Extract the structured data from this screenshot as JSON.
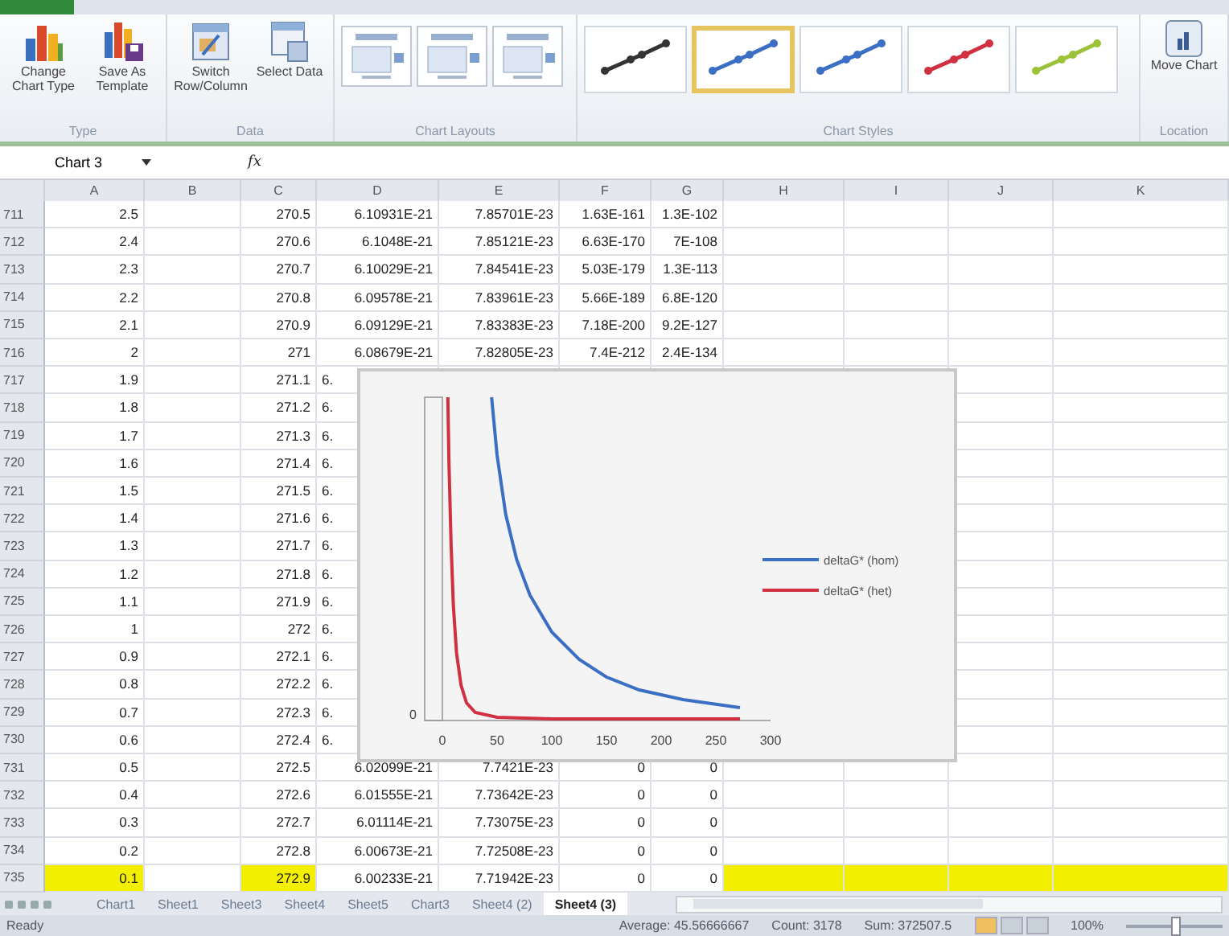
{
  "ribbon": {
    "groups": [
      {
        "label": "Type",
        "kind": "buttons",
        "buttons": [
          {
            "label": "Change Chart Type"
          },
          {
            "label": "Save As Template"
          }
        ]
      },
      {
        "label": "Data",
        "kind": "buttons",
        "buttons": [
          {
            "label": "Switch Row/Column"
          },
          {
            "label": "Select Data"
          }
        ]
      },
      {
        "label": "Chart Layouts",
        "kind": "layouts"
      },
      {
        "label": "Chart Styles",
        "kind": "styles",
        "styles": [
          {
            "color": "#333333",
            "selected": false
          },
          {
            "color": "#3b6fc4",
            "selected": true
          },
          {
            "color": "#3b6fc4",
            "selected": false
          },
          {
            "color": "#d03040",
            "selected": false
          },
          {
            "color": "#9cc23a",
            "selected": false
          }
        ]
      },
      {
        "label": "Location",
        "kind": "buttons",
        "buttons": [
          {
            "label": "Move Chart"
          }
        ]
      }
    ]
  },
  "formula_bar": {
    "name_box": "Chart 3",
    "fx": "fx"
  },
  "columns": [
    "A",
    "B",
    "C",
    "D",
    "E",
    "F",
    "G",
    "H",
    "I",
    "J",
    "K"
  ],
  "rows": [
    {
      "num": "711",
      "kind": "full",
      "cells": {
        "A": "2.5",
        "C": "270.5",
        "D": "6.10931E-21",
        "E": "7.85701E-23",
        "F": "1.63E-161",
        "G": "1.3E-102"
      }
    },
    {
      "num": "712",
      "kind": "full",
      "cells": {
        "A": "2.4",
        "C": "270.6",
        "D": "6.1048E-21",
        "E": "7.85121E-23",
        "F": "6.63E-170",
        "G": "7E-108"
      }
    },
    {
      "num": "713",
      "kind": "full",
      "cells": {
        "A": "2.3",
        "C": "270.7",
        "D": "6.10029E-21",
        "E": "7.84541E-23",
        "F": "5.03E-179",
        "G": "1.3E-113"
      }
    },
    {
      "num": "714",
      "kind": "full",
      "cells": {
        "A": "2.2",
        "C": "270.8",
        "D": "6.09578E-21",
        "E": "7.83961E-23",
        "F": "5.66E-189",
        "G": "6.8E-120"
      }
    },
    {
      "num": "715",
      "kind": "full",
      "cells": {
        "A": "2.1",
        "C": "270.9",
        "D": "6.09129E-21",
        "E": "7.83383E-23",
        "F": "7.18E-200",
        "G": "9.2E-127"
      }
    },
    {
      "num": "716",
      "kind": "full",
      "cells": {
        "A": "2",
        "C": "271",
        "D": "6.08679E-21",
        "E": "7.82805E-23",
        "F": "7.4E-212",
        "G": "2.4E-134"
      }
    },
    {
      "num": "717",
      "kind": "covered",
      "cells": {
        "A": "1.9",
        "C": "271.1",
        "D": "6."
      }
    },
    {
      "num": "718",
      "kind": "covered",
      "cells": {
        "A": "1.8",
        "C": "271.2",
        "D": "6."
      }
    },
    {
      "num": "719",
      "kind": "covered",
      "cells": {
        "A": "1.7",
        "C": "271.3",
        "D": "6."
      }
    },
    {
      "num": "720",
      "kind": "covered",
      "cells": {
        "A": "1.6",
        "C": "271.4",
        "D": "6."
      }
    },
    {
      "num": "721",
      "kind": "covered",
      "cells": {
        "A": "1.5",
        "C": "271.5",
        "D": "6."
      }
    },
    {
      "num": "722",
      "kind": "covered",
      "cells": {
        "A": "1.4",
        "C": "271.6",
        "D": "6."
      }
    },
    {
      "num": "723",
      "kind": "covered",
      "cells": {
        "A": "1.3",
        "C": "271.7",
        "D": "6."
      }
    },
    {
      "num": "724",
      "kind": "covered",
      "cells": {
        "A": "1.2",
        "C": "271.8",
        "D": "6."
      }
    },
    {
      "num": "725",
      "kind": "covered",
      "cells": {
        "A": "1.1",
        "C": "271.9",
        "D": "6."
      }
    },
    {
      "num": "726",
      "kind": "covered",
      "cells": {
        "A": "1",
        "C": "272",
        "D": "6."
      }
    },
    {
      "num": "727",
      "kind": "covered",
      "cells": {
        "A": "0.9",
        "C": "272.1",
        "D": "6."
      }
    },
    {
      "num": "728",
      "kind": "covered",
      "cells": {
        "A": "0.8",
        "C": "272.2",
        "D": "6."
      }
    },
    {
      "num": "729",
      "kind": "covered",
      "cells": {
        "A": "0.7",
        "C": "272.3",
        "D": "6."
      }
    },
    {
      "num": "730",
      "kind": "covered",
      "cells": {
        "A": "0.6",
        "C": "272.4",
        "D": "6."
      }
    },
    {
      "num": "731",
      "kind": "full",
      "cells": {
        "A": "0.5",
        "C": "272.5",
        "D": "6.02099E-21",
        "E": "7.7421E-23",
        "F": "0",
        "G": "0"
      }
    },
    {
      "num": "732",
      "kind": "full",
      "cells": {
        "A": "0.4",
        "C": "272.6",
        "D": "6.01555E-21",
        "E": "7.73642E-23",
        "F": "0",
        "G": "0"
      }
    },
    {
      "num": "733",
      "kind": "full",
      "cells": {
        "A": "0.3",
        "C": "272.7",
        "D": "6.01114E-21",
        "E": "7.73075E-23",
        "F": "0",
        "G": "0"
      }
    },
    {
      "num": "734",
      "kind": "full",
      "cells": {
        "A": "0.2",
        "C": "272.8",
        "D": "6.00673E-21",
        "E": "7.72508E-23",
        "F": "0",
        "G": "0"
      }
    },
    {
      "num": "735",
      "kind": "full",
      "cells": {
        "A": {
          "text": "0.1",
          "highlighted": true
        },
        "C": {
          "text": "272.9",
          "highlighted": true
        },
        "D": {
          "text": "6.00233E-21",
          "highlighted": false
        },
        "E": {
          "text": "7.71942E-23",
          "highlighted": false
        },
        "F": {
          "text": "0",
          "highlighted": false
        },
        "G": {
          "text": "0",
          "highlighted": false
        },
        "H": {
          "highlighted": true
        },
        "I": {
          "highlighted": true
        },
        "J": {
          "highlighted": true
        },
        "K": {
          "highlighted": true
        }
      }
    }
  ],
  "chart": {
    "y_tick": "0",
    "x_ticks": [
      "0",
      "50",
      "100",
      "150",
      "200",
      "250",
      "300"
    ],
    "legend": [
      {
        "label": "deltaG* (hom)",
        "color": "#3b6fc4"
      },
      {
        "label": "deltaG* (het)",
        "color": "#d03040"
      }
    ]
  },
  "sheet_tabs": [
    {
      "label": "Chart1",
      "selected": false
    },
    {
      "label": "Sheet1",
      "selected": false
    },
    {
      "label": "Sheet3",
      "selected": false
    },
    {
      "label": "Sheet4",
      "selected": false
    },
    {
      "label": "Sheet5",
      "selected": false
    },
    {
      "label": "Chart3",
      "selected": false
    },
    {
      "label": "Sheet4 (2)",
      "selected": false
    },
    {
      "label": "Sheet4 (3)",
      "selected": true
    }
  ],
  "status_bar": {
    "mode": "Ready",
    "average": "Average: 45.56666667",
    "count": "Count: 3178",
    "sum": "Sum: 372507.5",
    "zoom": "100%",
    "zoom_slider": {
      "level": 0.5
    }
  }
}
